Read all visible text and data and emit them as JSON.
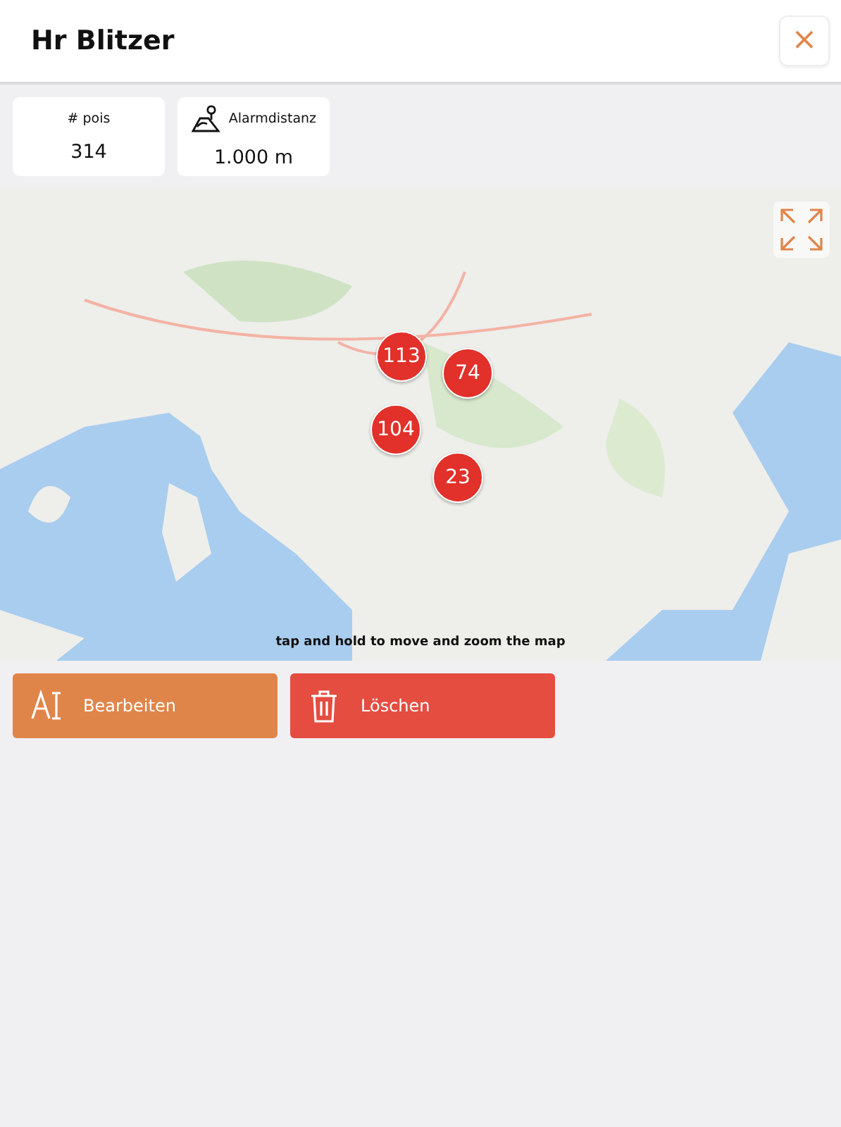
{
  "header": {
    "title": "Hr Blitzer",
    "close_button": "×"
  },
  "stats": [
    {
      "kind": "count",
      "label": "# pois",
      "value": "314"
    },
    {
      "kind": "distance",
      "label": "Alarmdistanz",
      "value": "1.000 m"
    }
  ],
  "map": {
    "clusters": [
      {
        "count": "113"
      },
      {
        "count": "74"
      },
      {
        "count": "104"
      },
      {
        "count": "23"
      }
    ],
    "hint": "tap and hold to move and zoom the map"
  },
  "actions": [
    {
      "kind": "edit",
      "label": "Bearbeiten"
    },
    {
      "kind": "delete",
      "label": "Löschen"
    }
  ]
}
